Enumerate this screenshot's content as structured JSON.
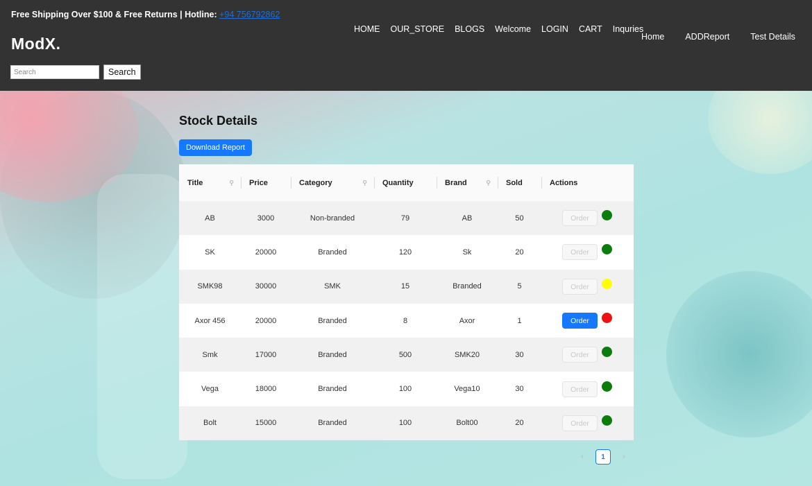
{
  "header": {
    "promo_text": "Free Shipping Over $100 & Free Returns | Hotline: ",
    "hotline": "+94 756792862",
    "logo": "ModX.",
    "search_placeholder": "Search",
    "search_button": "Search",
    "nav_main": [
      "HOME",
      "OUR_STORE",
      "BLOGS",
      "Welcome",
      "LOGIN",
      "CART",
      "Inquries"
    ],
    "nav_secondary": [
      "Home",
      "ADDReport",
      "Test Details"
    ]
  },
  "main": {
    "title": "Stock Details",
    "download_button": "Download Report",
    "table": {
      "columns": [
        "Title",
        "Price",
        "Category",
        "Quantity",
        "Brand",
        "Sold",
        "Actions"
      ],
      "order_label": "Order",
      "rows": [
        {
          "title": "AB",
          "price": "3000",
          "category": "Non-branded",
          "quantity": "79",
          "brand": "AB",
          "sold": "50",
          "order_enabled": false,
          "status_color": "#0a7d0a"
        },
        {
          "title": "SK",
          "price": "20000",
          "category": "Branded",
          "quantity": "120",
          "brand": "Sk",
          "sold": "20",
          "order_enabled": false,
          "status_color": "#0a7d0a"
        },
        {
          "title": "SMK98",
          "price": "30000",
          "category": "SMK",
          "quantity": "15",
          "brand": "Branded",
          "sold": "5",
          "order_enabled": false,
          "status_color": "#ffff00"
        },
        {
          "title": "Axor 456",
          "price": "20000",
          "category": "Branded",
          "quantity": "8",
          "brand": "Axor",
          "sold": "1",
          "order_enabled": true,
          "status_color": "#ee1111"
        },
        {
          "title": "Smk",
          "price": "17000",
          "category": "Branded",
          "quantity": "500",
          "brand": "SMK20",
          "sold": "30",
          "order_enabled": false,
          "status_color": "#0a7d0a"
        },
        {
          "title": "Vega",
          "price": "18000",
          "category": "Branded",
          "quantity": "100",
          "brand": "Vega10",
          "sold": "30",
          "order_enabled": false,
          "status_color": "#0a7d0a"
        },
        {
          "title": "Bolt",
          "price": "15000",
          "category": "Branded",
          "quantity": "100",
          "brand": "Bolt00",
          "sold": "20",
          "order_enabled": false,
          "status_color": "#0a7d0a"
        }
      ]
    },
    "pagination": {
      "prev_icon": "chevron-left-icon",
      "current_page": "1",
      "next_icon": "chevron-right-icon"
    }
  },
  "colors": {
    "header_bg": "#333333",
    "primary": "#1677ff"
  }
}
